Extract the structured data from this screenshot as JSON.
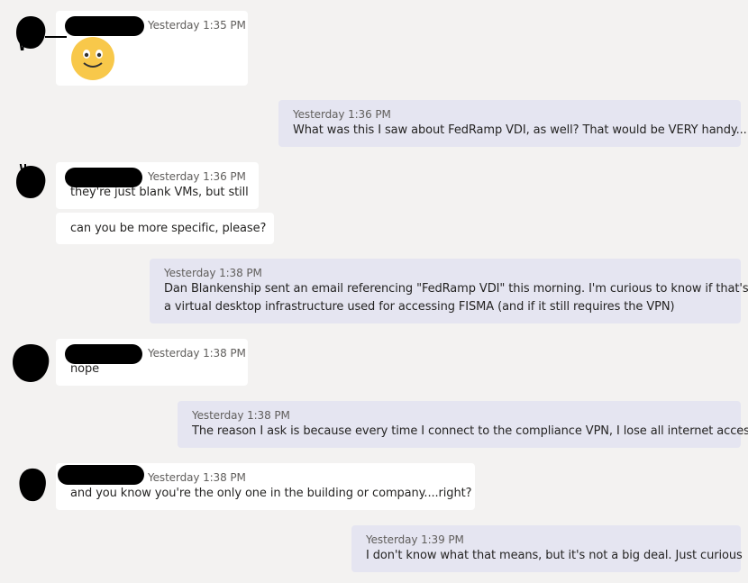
{
  "messages": [
    {
      "direction": "in",
      "time": "Yesterday 1:35 PM",
      "text": "",
      "emoji": "smile-emoji"
    },
    {
      "direction": "out",
      "time": "Yesterday 1:36 PM",
      "text": "What was this I saw about FedRamp VDI, as well? That would be VERY handy..."
    },
    {
      "direction": "in",
      "time": "Yesterday 1:36 PM",
      "text": "they're just blank VMs, but still"
    },
    {
      "direction": "in",
      "time": "",
      "text": "can you be more specific, please?"
    },
    {
      "direction": "out",
      "time": "Yesterday 1:38 PM",
      "text": "Dan Blankenship sent an email referencing \"FedRamp VDI\" this morning. I'm curious to know if that's",
      "text2": "a virtual desktop infrastructure used for accessing FISMA (and if it still requires the VPN)"
    },
    {
      "direction": "in",
      "time": "Yesterday 1:38 PM",
      "text": "nope"
    },
    {
      "direction": "out",
      "time": "Yesterday 1:38 PM",
      "text": "The reason I ask is because every time I connect to the compliance VPN, I lose all internet access"
    },
    {
      "direction": "in",
      "time": "Yesterday 1:38 PM",
      "text": "and you know you're the only one in the building or company....right?"
    },
    {
      "direction": "out",
      "time": "Yesterday 1:39 PM",
      "text": "I don't know what that means, but it's not a big deal. Just curious"
    }
  ],
  "colors": {
    "background": "#f3f2f1",
    "incoming": "#ffffff",
    "outgoing": "#e5e5f1",
    "redaction": "#000000"
  }
}
